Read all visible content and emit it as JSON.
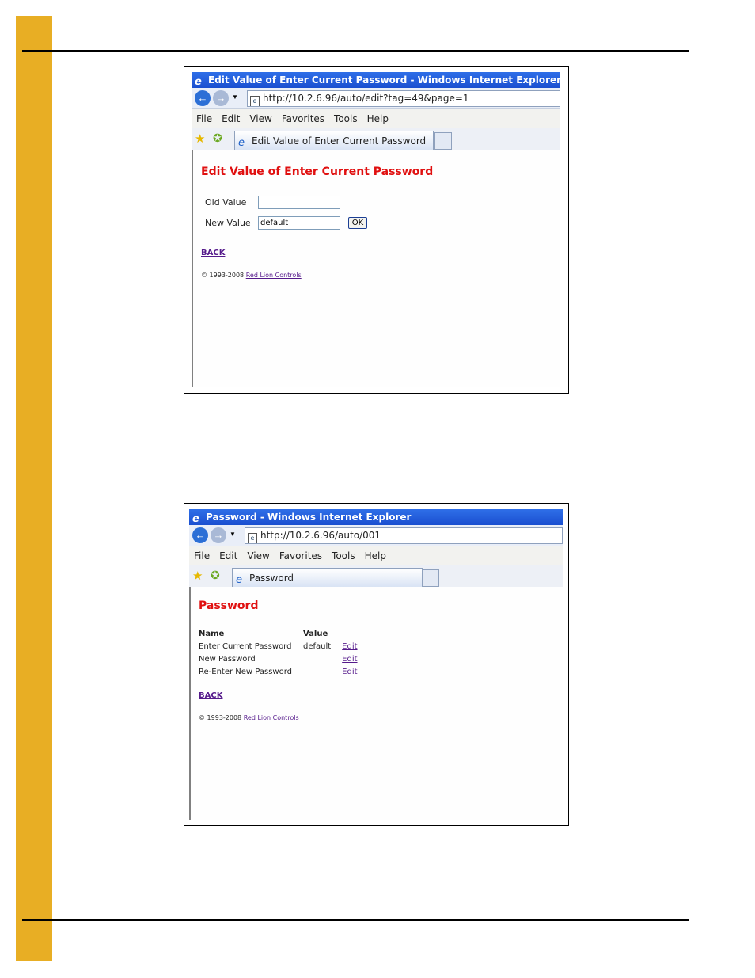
{
  "screenshot1": {
    "window_title": "Edit Value of Enter Current Password - Windows Internet Explorer",
    "address": "http://10.2.6.96/auto/edit?tag=49&page=1",
    "menu": [
      "File",
      "Edit",
      "View",
      "Favorites",
      "Tools",
      "Help"
    ],
    "tab_title": "Edit Value of Enter Current Password",
    "heading": "Edit Value of Enter Current Password",
    "old_value_label": "Old Value",
    "old_value": "",
    "new_value_label": "New Value",
    "new_value": "default",
    "ok_label": "OK",
    "back_label": "BACK",
    "copyright": "© 1993-2008",
    "copyright_link": "Red Lion Controls"
  },
  "screenshot2": {
    "window_title": "Password - Windows Internet Explorer",
    "address": "http://10.2.6.96/auto/001",
    "menu": [
      "File",
      "Edit",
      "View",
      "Favorites",
      "Tools",
      "Help"
    ],
    "tab_title": "Password",
    "heading": "Password",
    "table": {
      "headers": [
        "Name",
        "Value",
        ""
      ],
      "rows": [
        [
          "Enter Current Password",
          "default",
          "Edit"
        ],
        [
          "New Password",
          "",
          "Edit"
        ],
        [
          "Re-Enter New Password",
          "",
          "Edit"
        ]
      ]
    },
    "back_label": "BACK",
    "copyright": "© 1993-2008",
    "copyright_link": "Red Lion Controls"
  }
}
